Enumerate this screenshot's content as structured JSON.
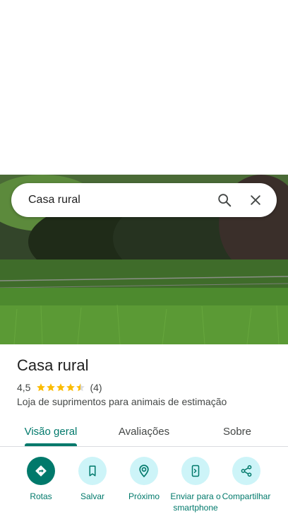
{
  "search": {
    "query": "Casa rural",
    "search_icon": "search-icon",
    "close_icon": "close-icon"
  },
  "place": {
    "title": "Casa rural",
    "rating": "4,5",
    "rating_value": 4.5,
    "review_count": "(4)",
    "category": "Loja de suprimentos para animais de estimação"
  },
  "tabs": [
    {
      "label": "Visão geral",
      "active": true
    },
    {
      "label": "Avaliações",
      "active": false
    },
    {
      "label": "Sobre",
      "active": false
    }
  ],
  "actions": [
    {
      "label": "Rotas",
      "icon": "directions-icon"
    },
    {
      "label": "Salvar",
      "icon": "bookmark-icon"
    },
    {
      "label": "Próximo",
      "icon": "nearby-icon"
    },
    {
      "label": "Enviar para o smartphone",
      "icon": "send-to-phone-icon"
    },
    {
      "label": "Compartilhar",
      "icon": "share-icon"
    }
  ],
  "colors": {
    "accent": "#00796b",
    "chip": "#cdf4f8",
    "star": "#fbbc04"
  }
}
